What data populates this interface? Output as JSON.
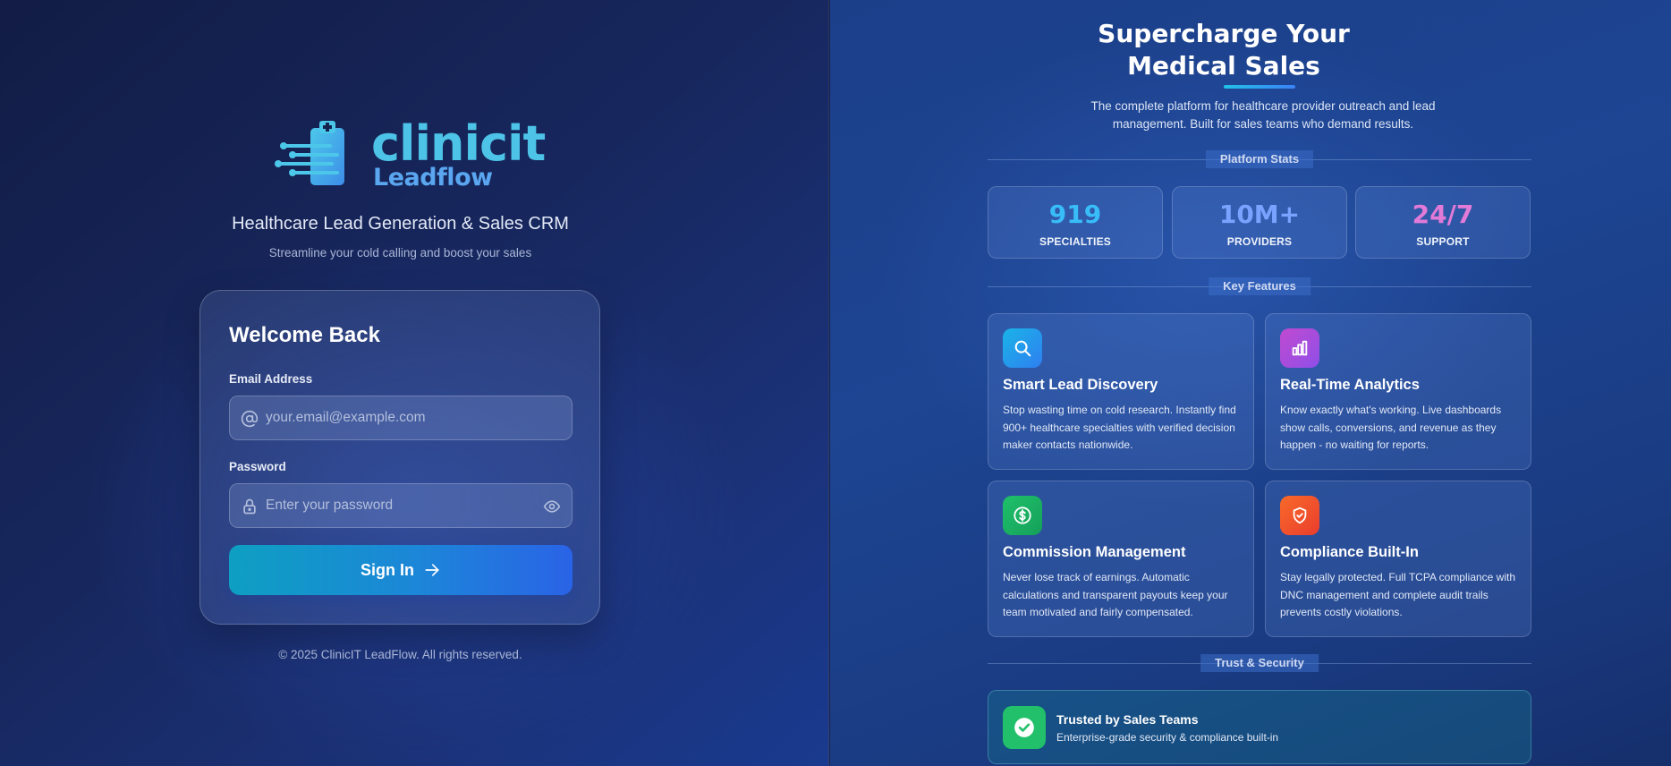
{
  "brand": {
    "logo_word": "clinicit",
    "logo_sub": "Leadflow",
    "tagline": "Healthcare Lead Generation & Sales CRM",
    "subtagline": "Streamline your cold calling and boost your sales"
  },
  "login": {
    "title": "Welcome Back",
    "email_label": "Email Address",
    "email_placeholder": "your.email@example.com",
    "email_value": "",
    "password_label": "Password",
    "password_placeholder": "Enter your password",
    "password_value": "",
    "submit_label": "Sign In"
  },
  "footer": {
    "copyright": "© 2025 ClinicIT LeadFlow. All rights reserved."
  },
  "hero": {
    "title_line1": "Supercharge Your",
    "title_line2": "Medical Sales",
    "subtitle": "The complete platform for healthcare provider outreach and lead management. Built for sales teams who demand results."
  },
  "sections": {
    "stats": "Platform Stats",
    "features": "Key Features",
    "trust": "Trust & Security"
  },
  "stats": [
    {
      "value": "919",
      "label": "SPECIALTIES",
      "color": "#38bdf8"
    },
    {
      "value": "10M+",
      "label": "PROVIDERS",
      "color": "#7aa2ff"
    },
    {
      "value": "24/7",
      "label": "SUPPORT",
      "color": "#e27ad8"
    }
  ],
  "features": [
    {
      "title": "Smart Lead Discovery",
      "description": "Stop wasting time on cold research. Instantly find 900+ healthcare specialties with verified decision maker contacts nationwide.",
      "icon": "search-icon",
      "color": "#1ea7e8"
    },
    {
      "title": "Real-Time Analytics",
      "description": "Know exactly what's working. Live dashboards show calls, conversions, and revenue as they happen - no waiting for reports.",
      "icon": "bar-chart-icon",
      "color": "#b64fd6"
    },
    {
      "title": "Commission Management",
      "description": "Never lose track of earnings. Automatic calculations and transparent payouts keep your team motivated and fairly compensated.",
      "icon": "dollar-icon",
      "color": "#1fb463"
    },
    {
      "title": "Compliance Built-In",
      "description": "Stay legally protected. Full TCPA compliance with DNC management and complete audit trails prevents costly violations.",
      "icon": "shield-check-icon",
      "color": "#f2562a"
    }
  ],
  "trust": {
    "title": "Trusted by Sales Teams",
    "subtitle": "Enterprise-grade security & compliance built-in",
    "icon": "check-circle-icon",
    "color": "#22c06a"
  }
}
